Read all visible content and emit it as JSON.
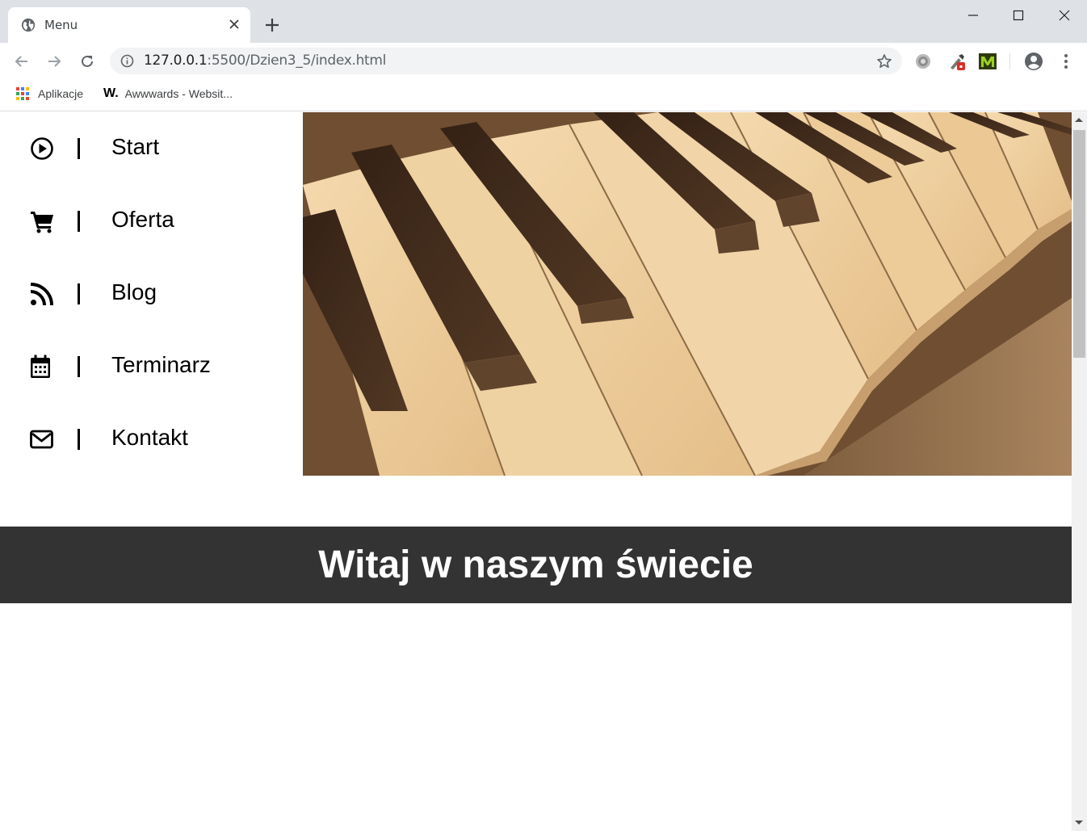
{
  "browser": {
    "tab_title": "Menu",
    "url_host": "127.0.0.1",
    "url_rest": ":5500/Dzien3_5/index.html",
    "bookmarks": [
      {
        "label": "Aplikacje",
        "icon": "apps-grid-icon"
      },
      {
        "label": "Awwwards - Websit...",
        "icon": "awwwards-logo-icon"
      }
    ]
  },
  "menu": {
    "items": [
      {
        "label": "Start",
        "icon": "play-circle-icon"
      },
      {
        "label": "Oferta",
        "icon": "shopping-cart-icon"
      },
      {
        "label": "Blog",
        "icon": "rss-feed-icon"
      },
      {
        "label": "Terminarz",
        "icon": "calendar-icon"
      },
      {
        "label": "Kontakt",
        "icon": "envelope-icon"
      }
    ],
    "separator": "|"
  },
  "hero": {
    "image": "piano-keys-sepia-photo"
  },
  "welcome": {
    "heading": "Witaj w naszym świecie"
  },
  "colors": {
    "welcome_bg": "#333333",
    "welcome_text": "#ffffff",
    "menu_text": "#000000"
  }
}
